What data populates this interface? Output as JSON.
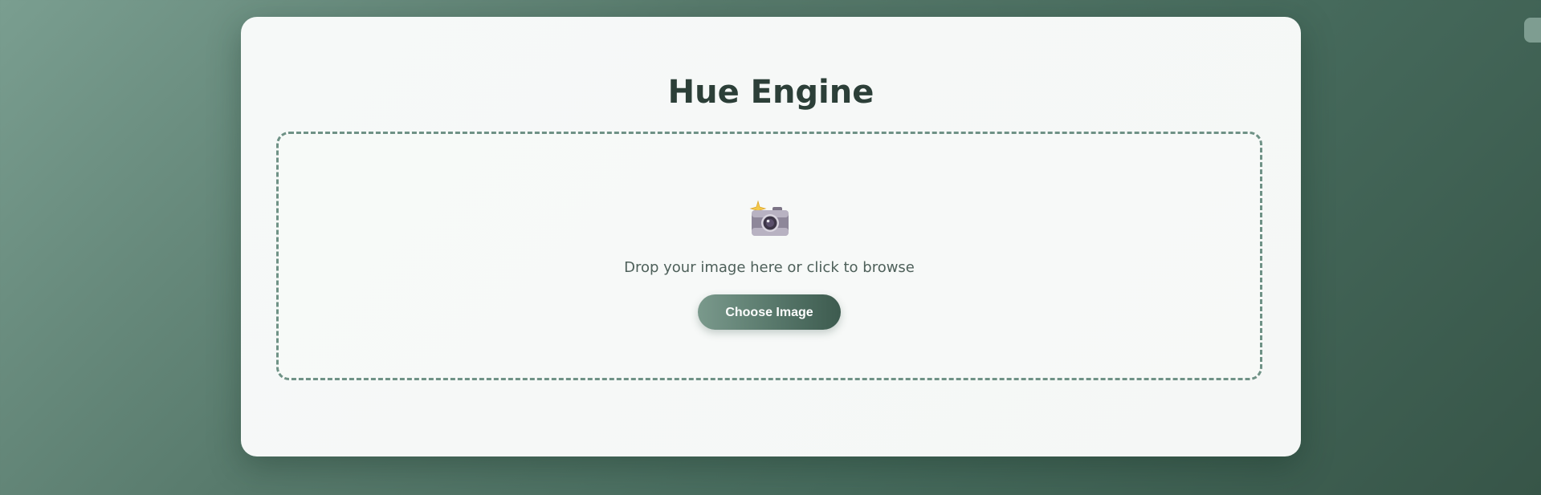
{
  "app": {
    "title": "Hue Engine"
  },
  "upload": {
    "icon": "camera-flash-icon",
    "prompt": "Drop your image here or click to browse",
    "button_label": "Choose Image"
  },
  "colors": {
    "accent": "#5a7a6d",
    "accent_dark": "#3d5b4f",
    "title_text": "#2c3f38",
    "dropzone_border": "#6f9286"
  }
}
